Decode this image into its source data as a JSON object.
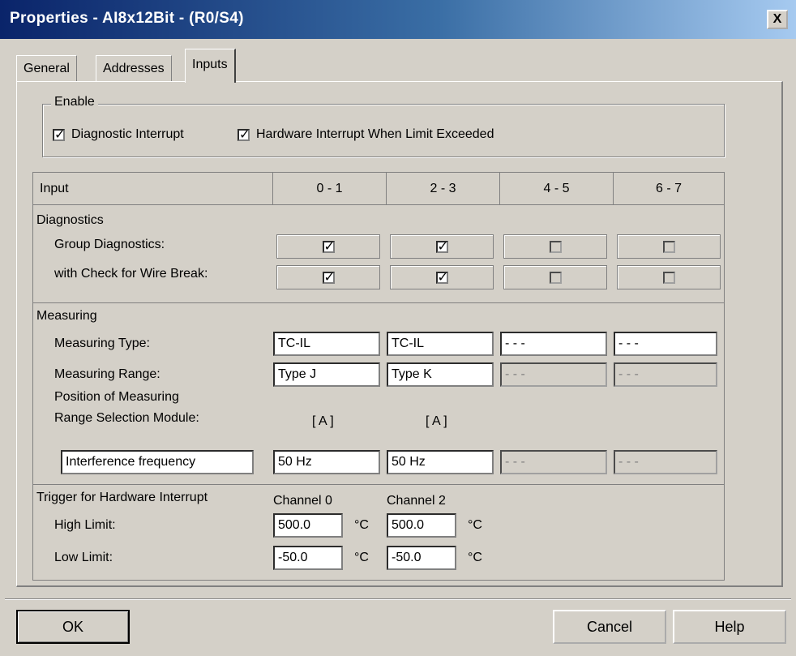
{
  "window": {
    "title": "Properties - AI8x12Bit - (R0/S4)",
    "close_label": "X"
  },
  "tabs": [
    {
      "label": "General"
    },
    {
      "label": "Addresses"
    },
    {
      "label": "Inputs",
      "active": true
    }
  ],
  "enable": {
    "legend": "Enable",
    "diagnostic_interrupt": {
      "label": "Diagnostic Interrupt",
      "checked": true
    },
    "hardware_interrupt": {
      "label": "Hardware Interrupt When Limit Exceeded",
      "checked": true
    }
  },
  "table": {
    "header_input": "Input",
    "columns": [
      "0 - 1",
      "2 - 3",
      "4 - 5",
      "6 - 7"
    ],
    "diagnostics": {
      "title": "Diagnostics",
      "group_label": "Group Diagnostics:",
      "wire_label": "with Check for Wire Break:",
      "group_checked": [
        true,
        true,
        false,
        false
      ],
      "wire_checked": [
        true,
        true,
        false,
        false
      ]
    },
    "measuring": {
      "title": "Measuring",
      "type_label": "Measuring Type:",
      "type_values": [
        "TC-IL",
        "TC-IL",
        "- - -",
        "- - -"
      ],
      "range_label": "Measuring Range:",
      "range_values": [
        "Type J",
        "Type K",
        "- - -",
        "- - -"
      ],
      "position_label_1": "Position of Measuring",
      "position_label_2": "Range Selection Module:",
      "position_values": [
        "[ A ]",
        "[ A ]"
      ],
      "interference_label": "Interference frequency",
      "interference_values": [
        "50 Hz",
        "50 Hz",
        "- - -",
        "- - -"
      ]
    },
    "trigger": {
      "title": "Trigger for Hardware Interrupt",
      "channel_0": "Channel 0",
      "channel_2": "Channel 2",
      "high_label": "High Limit:",
      "low_label": "Low Limit:",
      "high_values": [
        "500.0",
        "500.0"
      ],
      "low_values": [
        "-50.0",
        "-50.0"
      ],
      "unit": "°C"
    }
  },
  "buttons": {
    "ok": "OK",
    "cancel": "Cancel",
    "help": "Help"
  }
}
